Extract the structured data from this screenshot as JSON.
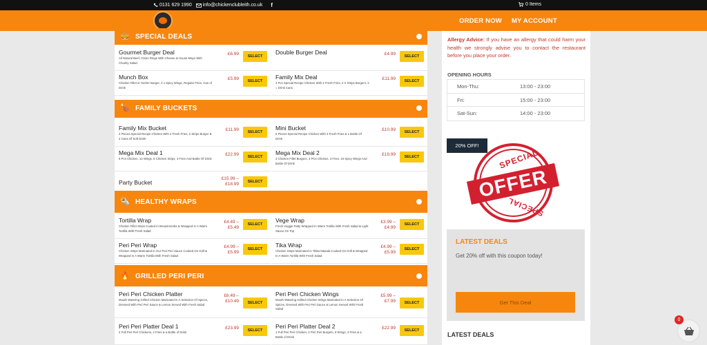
{
  "topbar": {
    "phone": "0131 629 1990",
    "email": "info@chickenclubleith.co.uk",
    "cart_label": "0 Items"
  },
  "nav": {
    "order_now": "ORDER NOW",
    "my_account": "MY ACCOUNT"
  },
  "sections": [
    {
      "title": "SPECIAL DEALS",
      "items": [
        {
          "name": "Gourmet Burger Deal",
          "desc": "All Natural Beef, Onion Rings With Cheese & House Mayo With Chunky Salad",
          "price": "£6.99",
          "select": "SELECT"
        },
        {
          "name": "Double Burger Deal",
          "desc": "",
          "price": "£4.99",
          "select": "SELECT"
        },
        {
          "name": "Munch Box",
          "desc": "Chicken Fillet or Sizzler Burger, 2 x Spicy Wings, Regular Fries, Can of Drink",
          "price": "£5.99",
          "select": "SELECT"
        },
        {
          "name": "Family Mix Deal",
          "desc": "4 Pcs Special Recipe Chicken With 2 Fresh Fries, 2 X Strips Burgers, 2 = Drink Cans",
          "price": "£11.99",
          "select": "SELECT"
        }
      ]
    },
    {
      "title": "FAMILY BUCKETS",
      "items": [
        {
          "name": "Family Mix Bucket",
          "desc": "4 Pieces Special Recipe Chicken With 2 Fresh Fries, 2 Strips Burger & 2 Cans Of Soft Drink",
          "price": "£11.99",
          "select": "SELECT"
        },
        {
          "name": "Mini Bucket",
          "desc": "6 Pieces Special Recipe Chicken With 3 Fresh Fries & 1 Bottle Of Drink",
          "price": "£10.99",
          "select": "SELECT"
        },
        {
          "name": "Mega Mix Deal 1",
          "desc": "8 Pcs Chicken, 12 Wings, 6 Chicken Strips, 4 Fries And Bottle Of Drink",
          "price": "£22.99",
          "select": "SELECT"
        },
        {
          "name": "Mega Mix Deal 2",
          "desc": "3 Chicken Fillet Burgers, 3 PCs Chicken, 3 Fries, 10 Spicy Wings And Bottle Of Drink",
          "price": "£19.99",
          "select": "SELECT"
        },
        {
          "name": "Party Bucket",
          "desc": "",
          "price": "£15.99 – £18.99",
          "select": "SELECT"
        }
      ]
    },
    {
      "title": "HEALTHY WRAPS",
      "items": [
        {
          "name": "Tortilla Wrap",
          "desc": "Chicken Fillet Strips Coated In Breadcrumbs & Wrapped In A Warm Tortilla With Fresh Salad",
          "price": "£4.49 – £5.49",
          "select": "SELECT"
        },
        {
          "name": "Vege Wrap",
          "desc": "Fresh Veggie Patty Wrapped In Warm Tortilla With Fresh Salad & Light Sauce On Top",
          "price": "£3.99 – £4.99",
          "select": "SELECT"
        },
        {
          "name": "Peri Peri Wrap",
          "desc": "Chicken Strips Marinated In Our Peri Peri Sauce Cooked On Grill & Wrapped In A Warm Tortilla With Fresh Salad",
          "price": "£4.99 – £5.99",
          "select": "SELECT"
        },
        {
          "name": "Tika Wrap",
          "desc": "Chicken Strips Marinated In Tikka Masala Cooked On Grill & Wrapped In A Warm Tortilla With Fresh Salad",
          "price": "£4.99 – £5.99",
          "select": "SELECT"
        }
      ]
    },
    {
      "title": "GRILLED PERI PERI",
      "items": [
        {
          "name": "Peri Peri Chicken Platter",
          "desc": "Mouth Watering Grilled Chicken Marinated In A Selection Of Spices, Dressed With Peri Peri Sauce & Lemon Served With Fresh Salad",
          "price": "£6.49 – £10.49",
          "select": "SELECT"
        },
        {
          "name": "Peri Peri Chicken Wings",
          "desc": "Mouth Watering Grilled Chicken Wings Marinated In A Selection Of Spices, Dressed With Peri Peri Sauce & Lemon Served With Fresh Salad",
          "price": "£5.99 – £7.99",
          "select": "SELECT"
        },
        {
          "name": "Peri Peri Platter Deal 1",
          "desc": "2 Full Peri Peri Chickens, 4 Fries & a Bottle of Drink",
          "price": "£23.99",
          "select": "SELECT"
        },
        {
          "name": "Peri Peri Platter Deal 2",
          "desc": "1 Full Peri Peri Chicken, 2 Peri Peri Burgers, 8 Wings, 4 Fries & a Bottle of Drink",
          "price": "£22.99",
          "select": "SELECT"
        }
      ]
    }
  ],
  "sidebar": {
    "allergy_label": "Allergy Advice:",
    "allergy_text": "If you have an allergy that could harm your health we strongly advise you to contact the restaurant before you place your order.",
    "hours_title": "OPENING HOURS",
    "hours": [
      {
        "day": "Mon-Thu:",
        "time": "13:00 - 23:00"
      },
      {
        "day": "Fri:",
        "time": "15:00 - 23:00"
      },
      {
        "day": "Sat-Sun:",
        "time": "14:00 - 23:00"
      }
    ],
    "offer_badge": "20% OFF!",
    "stamp_top": "SPECIAL",
    "stamp_main": "OFFER",
    "stamp_bottom": "SPECIAL",
    "latest_deals_title": "LATEST DEALS",
    "latest_deals_text": "Get 20% off with this coupon today!",
    "deal_button": "Get This Deal",
    "latest_deals_bottom": "LATEST DEALS"
  },
  "floating_cart": {
    "count": "0"
  },
  "colors": {
    "brand_orange": "#f7860f",
    "select_yellow": "#f9c80e",
    "price_red": "#c0392b",
    "stamp_red": "#d3202f"
  }
}
